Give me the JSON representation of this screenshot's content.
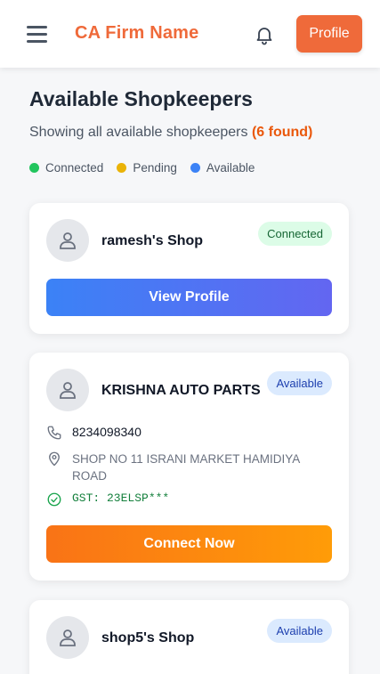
{
  "header": {
    "brand": "CA Firm Name",
    "profile_label": "Profile",
    "icons": [
      "menu-icon",
      "bell-icon"
    ]
  },
  "page": {
    "title": "Available Shopkeepers",
    "subtitle_prefix": "Showing all available shopkeepers",
    "count_label": "(6 found)"
  },
  "legend": [
    {
      "label": "Connected",
      "color": "#22c55e"
    },
    {
      "label": "Pending",
      "color": "#eab308"
    },
    {
      "label": "Available",
      "color": "#3b82f6"
    }
  ],
  "shops": [
    {
      "name": "ramesh's Shop",
      "status": "Connected",
      "action": "View Profile"
    },
    {
      "name": "KRISHNA AUTO PARTS",
      "status": "Available",
      "phone": "8234098340",
      "address": "SHOP NO 11 ISRANI MARKET HAMIDIYA ROAD",
      "gst": "GST: 23ELSP***",
      "action": "Connect Now"
    },
    {
      "name": "shop5's Shop",
      "status": "Available"
    }
  ],
  "colors": {
    "accent": "#ef6a3a",
    "connected_badge": "#dcfce7",
    "available_badge": "#dbeafe"
  }
}
